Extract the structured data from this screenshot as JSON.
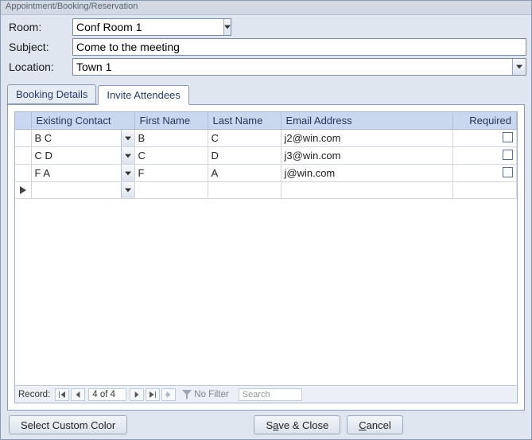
{
  "window": {
    "title": "Appointment/Booking/Reservation"
  },
  "fields": {
    "room": {
      "label": "Room:",
      "value": "Conf Room 1"
    },
    "subject": {
      "label": "Subject:",
      "value": "Come to the meeting"
    },
    "location": {
      "label": "Location:",
      "value": "Town 1"
    }
  },
  "tabs": {
    "booking": "Booking Details",
    "invite": "Invite Attendees"
  },
  "grid": {
    "headers": {
      "contact": "Existing Contact",
      "first": "First Name",
      "last": "Last Name",
      "email": "Email Address",
      "required": "Required"
    },
    "rows": [
      {
        "contact": "B C",
        "first": "B",
        "last": "C",
        "email": "j2@win.com",
        "required": false
      },
      {
        "contact": "C D",
        "first": "C",
        "last": "D",
        "email": "j3@win.com",
        "required": false
      },
      {
        "contact": "F A",
        "first": "F",
        "last": "A",
        "email": "j@win.com",
        "required": false
      }
    ]
  },
  "recordnav": {
    "label": "Record:",
    "position": "4 of 4",
    "filter": "No Filter",
    "search_placeholder": "Search"
  },
  "footer": {
    "customcolor": "Select Custom Color",
    "saveclose_pre": "S",
    "saveclose_u": "a",
    "saveclose_post": "ve & Close",
    "cancel_u": "C",
    "cancel_post": "ancel"
  }
}
